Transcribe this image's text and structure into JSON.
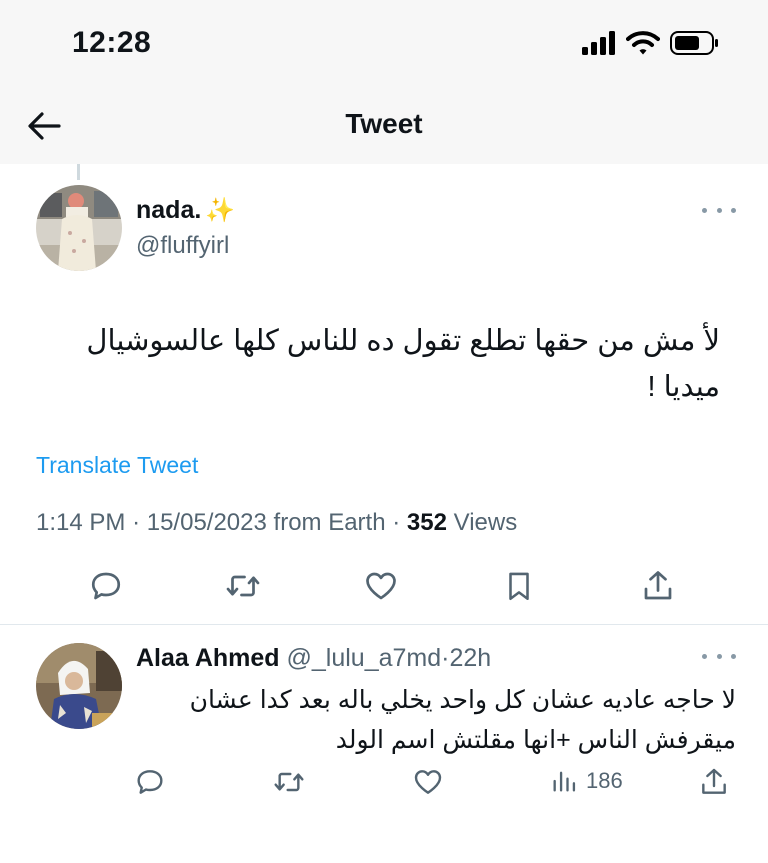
{
  "status_bar": {
    "time": "12:28"
  },
  "nav": {
    "title": "Tweet"
  },
  "tweet": {
    "display_name": "nada.",
    "emoji": "✨",
    "handle": "@fluffyirl",
    "text": "لأ مش من حقها تطلع تقول ده للناس كلها عالسوشيال ميديا !",
    "translate_label": "Translate Tweet",
    "time": "1:14 PM",
    "date": "15/05/2023",
    "source": "from Earth",
    "views_count": "352",
    "views_label": "Views",
    "sep": "·"
  },
  "reply": {
    "display_name": "Alaa Ahmed",
    "handle": "@_lulu_a7md",
    "sep": "·",
    "time": "22h",
    "text": "لا حاجه عاديه عشان كل واحد يخلي باله بعد كدا عشان ميقرفش الناس +انها مقلتش اسم الولد",
    "views": "186"
  },
  "icons": {
    "back": "back-arrow-icon",
    "reply": "reply-icon",
    "retweet": "retweet-icon",
    "like": "heart-icon",
    "bookmark": "bookmark-icon",
    "share": "share-icon",
    "views": "views-chart-icon",
    "more": "more-dots-icon"
  },
  "colors": {
    "link": "#1d9bf0",
    "secondary": "#536471",
    "text": "#0f1419"
  }
}
